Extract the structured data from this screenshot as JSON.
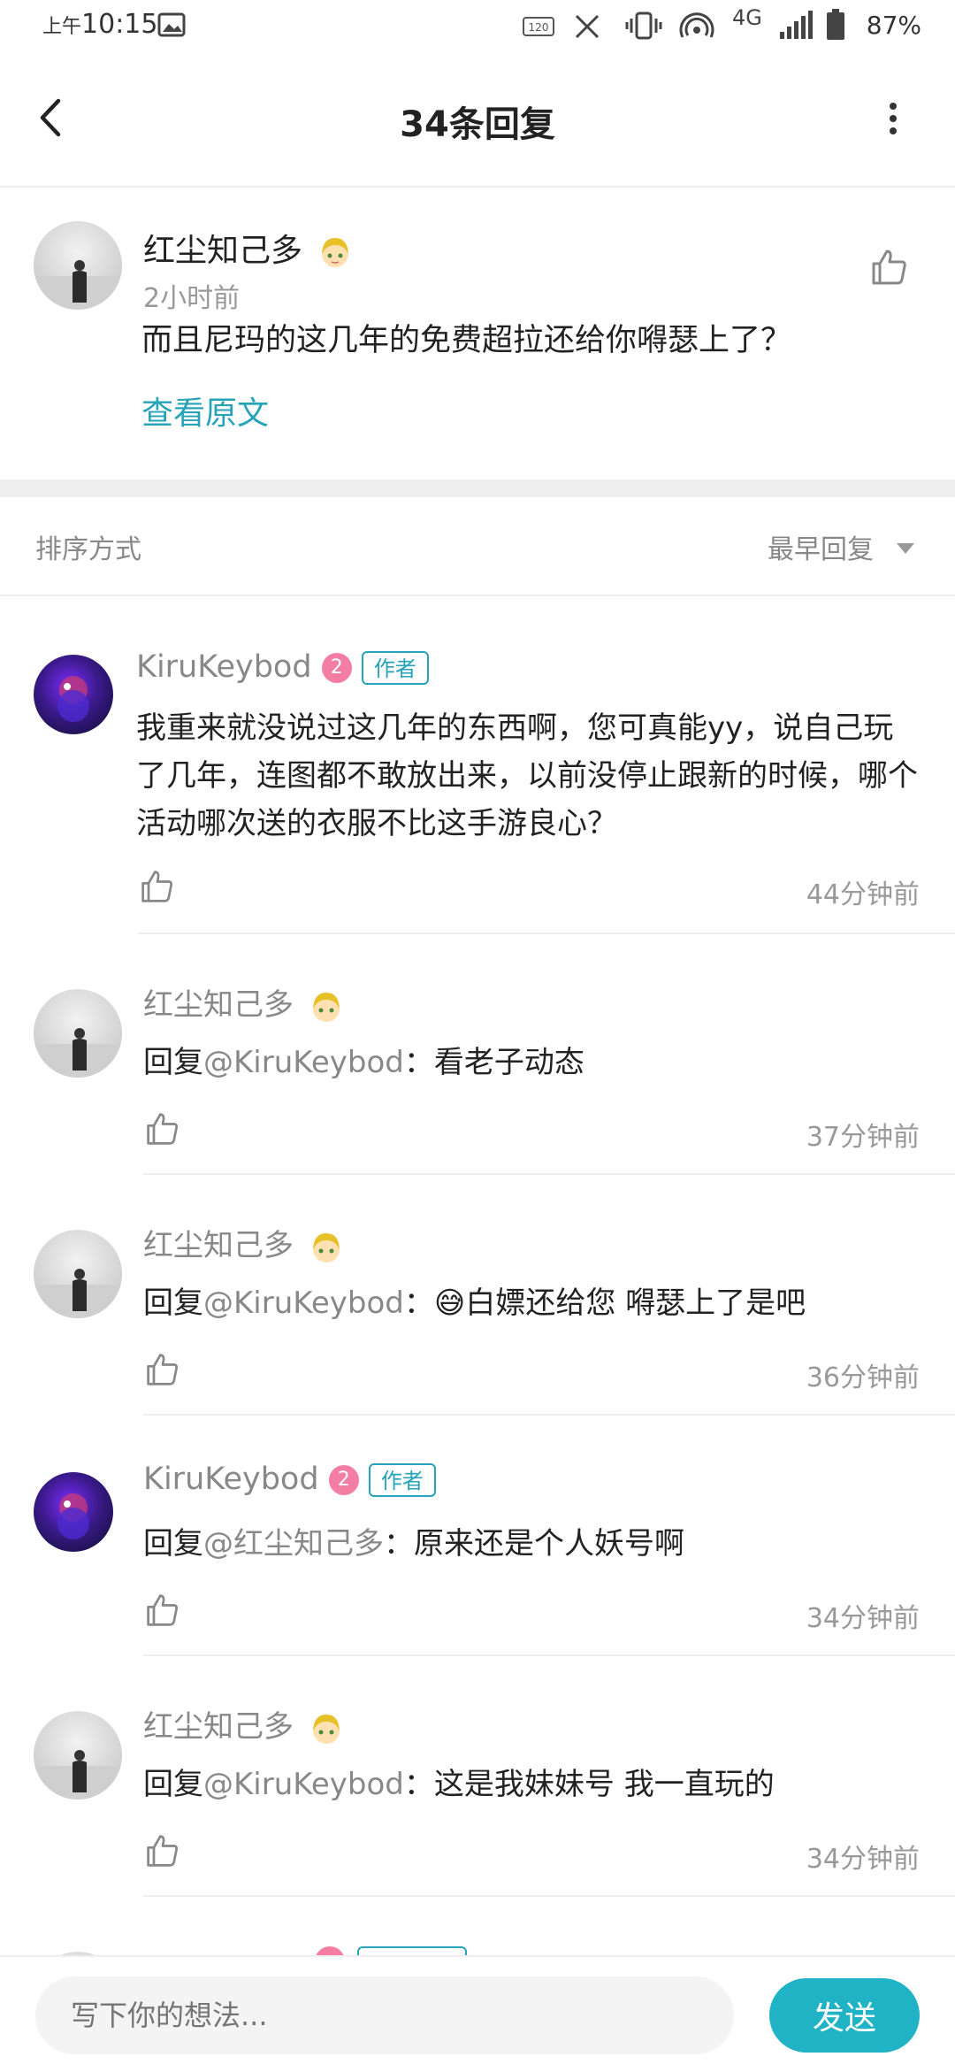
{
  "status_bar": {
    "time_prefix": "上午",
    "time": "10:15",
    "battery": "87%",
    "network": "4G"
  },
  "header": {
    "title": "34条回复"
  },
  "original": {
    "username": "红尘知己多",
    "time": "2小时前",
    "text": "而且尼玛的这几年的免费超拉还给你嘚瑟上了？",
    "view_original": "查看原文"
  },
  "sort": {
    "label": "排序方式",
    "value": "最早回复"
  },
  "replies": [
    {
      "username": "KiruKeybod",
      "level": "2",
      "author_tag": "作者",
      "prefix": "",
      "mention": "",
      "text": "我重来就没说过这几年的东西啊，您可真能yy，说自己玩了几年，连图都不敢放出来，以前没停止跟新的时候，哪个活动哪次送的衣服不比这手游良心？",
      "time": "44分钟前"
    },
    {
      "username": "红尘知己多",
      "prefix": "回复",
      "mention": "@KiruKeybod",
      "text": "：看老子动态",
      "time": "37分钟前"
    },
    {
      "username": "红尘知己多",
      "prefix": "回复",
      "mention": "@KiruKeybod",
      "text": "：😅白嫖还给您 嘚瑟上了是吧",
      "time": "36分钟前"
    },
    {
      "username": "KiruKeybod",
      "level": "2",
      "author_tag": "作者",
      "prefix": "回复",
      "mention": "@红尘知己多",
      "text": "：原来还是个人妖号啊",
      "time": "34分钟前"
    },
    {
      "username": "红尘知己多",
      "prefix": "回复",
      "mention": "@KiruKeybod",
      "text": "：这是我妹妹号 我一直玩的",
      "time": "34分钟前"
    }
  ],
  "composer": {
    "placeholder": "写下你的想法...",
    "send_label": "发送"
  },
  "colors": {
    "accent": "#26a3b8",
    "send_button": "#1fb3c5",
    "level_badge": "#f47ea3"
  }
}
